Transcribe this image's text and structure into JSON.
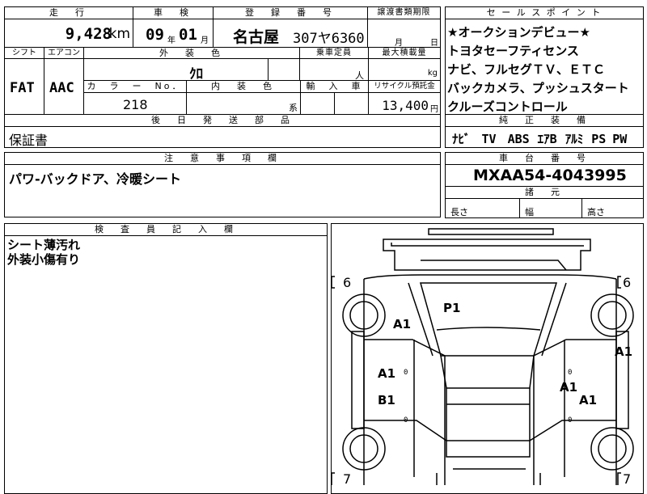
{
  "top_block": {
    "mileage_header": "走　行",
    "mileage_value": "9,428",
    "mileage_unit": "km",
    "inspection_header": "車　検",
    "inspection_year": "09",
    "inspection_year_unit": "年",
    "inspection_month": "01",
    "inspection_month_unit": "月",
    "registration_header": "登　録　番　号",
    "registration_region": "名古屋",
    "registration_number": "307ヤ6360",
    "transfer_header": "譲渡書類期限",
    "transfer_month": "月",
    "transfer_day": "日",
    "shift_header": "シフト",
    "shift_value": "FAT",
    "aircon_header": "エアコン",
    "aircon_value": "AAC",
    "exterior_color_header": "外　装　色",
    "exterior_color_value": "ｸﾛ",
    "capacity_header": "乗車定員",
    "capacity_unit": "人",
    "max_load_header": "最大積載量",
    "max_load_unit": "kg",
    "color_no_header": "カ　ラ　ー　No．",
    "color_no_value": "218",
    "interior_color_header": "内　装　色",
    "interior_color_unit": "系",
    "import_header": "輸　入　車",
    "recycle_header": "リサイクル預託金",
    "recycle_value": "13,400",
    "recycle_unit": "円",
    "later_parts_header": "後　日　発　送　部　品",
    "later_parts_value": "保証書",
    "notes_header": "注　意　事　項　欄",
    "notes_value": "パワ-バックドア、冷暖シート"
  },
  "sales_points": {
    "header": "セ ー ル ス ポ イ ン ト",
    "lines": [
      "★オークションデビュー★",
      "トヨタセーフティセンス",
      "ナビ、フルセグＴＶ、ＥＴＣ",
      "バックカメラ、プッシュスタート",
      "クルーズコントロール"
    ]
  },
  "equipment": {
    "header": "純　正　装　備",
    "items": [
      "ﾅﾋﾞ",
      "TV",
      "ABS",
      "ｴｱB",
      "ｱﾙﾐ",
      "PS",
      "PW"
    ]
  },
  "chassis": {
    "header": "車　台　番　号",
    "value": "MXAA54-4043995"
  },
  "dimensions": {
    "header": "諸　元",
    "length_label": "長さ",
    "width_label": "幅",
    "height_label": "高さ"
  },
  "inspector": {
    "header": "検　査　員　記　入　欄",
    "lines": [
      "シート薄汚れ",
      "外装小傷有り"
    ]
  },
  "diagram": {
    "marks": {
      "p1": "P1",
      "a1_upper_left": "A1",
      "a1_left_door": "A1",
      "b1_left_door": "B1",
      "a1_right_edge": "A1",
      "a1_right_door_top": "A1",
      "a1_right_door_bottom": "A1"
    },
    "tags": {
      "front_left": "6",
      "front_right": "6",
      "rear_left": "7",
      "rear_right": "7"
    },
    "zero": "0"
  }
}
